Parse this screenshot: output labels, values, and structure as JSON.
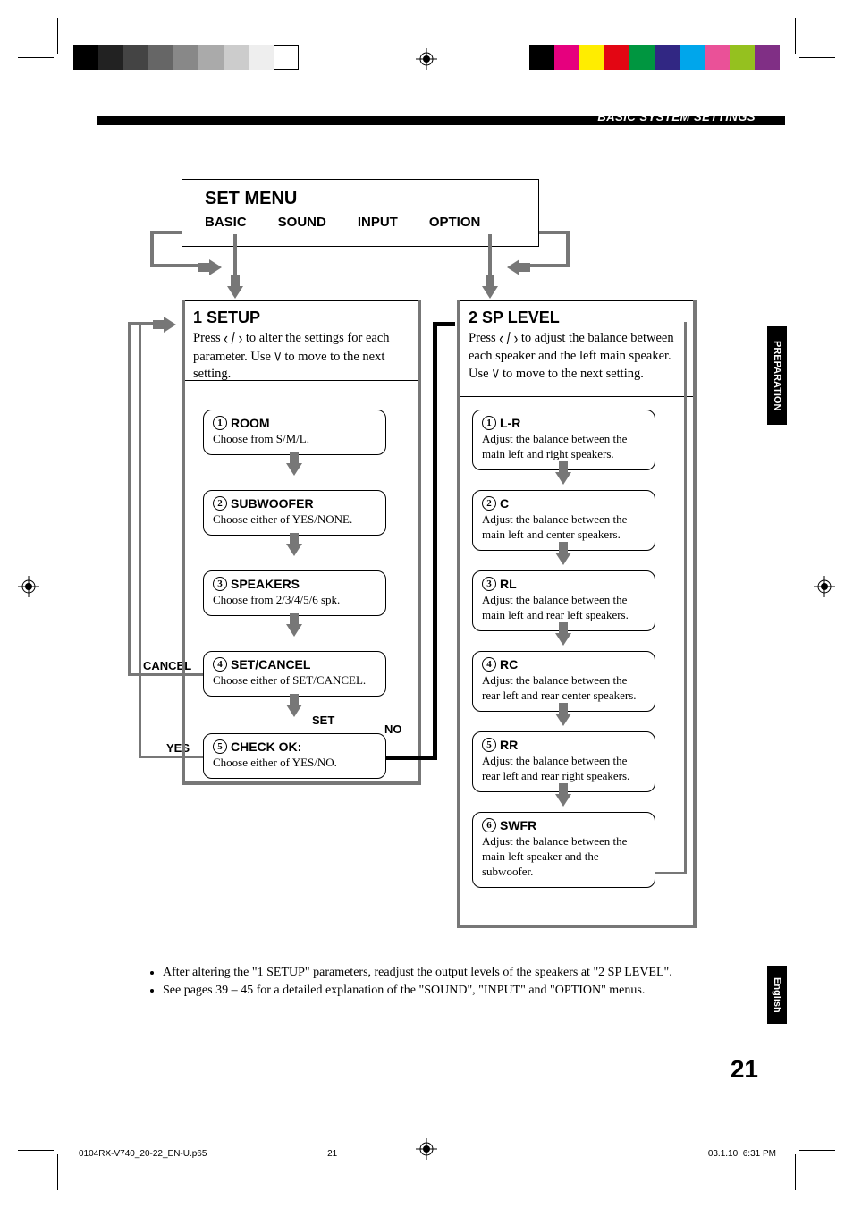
{
  "section_header": "BASIC SYSTEM SETTINGS",
  "side_tab_1": "PREPARATION",
  "side_tab_2": "English",
  "page_number": "21",
  "menu": {
    "title": "SET MENU",
    "items": [
      "BASIC",
      "SOUND",
      "INPUT",
      "OPTION"
    ]
  },
  "setup": {
    "title": "1   SETUP",
    "desc_a": "Press ",
    "desc_b": " to alter the settings for each parameter. Use ",
    "desc_c": " to move to the next setting.",
    "steps": [
      {
        "n": "1",
        "title": "ROOM",
        "text": "Choose from S/M/L."
      },
      {
        "n": "2",
        "title": "SUBWOOFER",
        "text": "Choose either of YES/NONE."
      },
      {
        "n": "3",
        "title": "SPEAKERS",
        "text": "Choose from 2/3/4/5/6 spk."
      },
      {
        "n": "4",
        "title": "SET/CANCEL",
        "text": "Choose either of SET/CANCEL."
      },
      {
        "n": "5",
        "title": "CHECK OK:",
        "text": "Choose either of YES/NO."
      }
    ]
  },
  "splevel": {
    "title": "2   SP LEVEL",
    "desc_a": "Press ",
    "desc_b": " to adjust the balance between each speaker and the left main speaker. Use ",
    "desc_c": " to move to the next setting.",
    "steps": [
      {
        "n": "1",
        "title": "L-R",
        "text": "Adjust the balance between the main left and right speakers."
      },
      {
        "n": "2",
        "title": "C",
        "text": "Adjust the balance between the main left and center speakers."
      },
      {
        "n": "3",
        "title": "RL",
        "text": "Adjust the balance between the main left and rear left speakers."
      },
      {
        "n": "4",
        "title": "RC",
        "text": "Adjust the balance between the rear left and rear center speakers."
      },
      {
        "n": "5",
        "title": "RR",
        "text": "Adjust the balance between the rear left and rear right speakers."
      },
      {
        "n": "6",
        "title": "SWFR",
        "text": "Adjust the balance between the main left speaker and the subwoofer."
      }
    ]
  },
  "labels": {
    "cancel": "CANCEL",
    "set": "SET",
    "yes": "YES",
    "no": "NO"
  },
  "notes": {
    "a": "After altering the \"1 SETUP\" parameters, readjust the output levels of the speakers at \"2 SP LEVEL\".",
    "b": "See pages 39 – 45 for a detailed explanation of the \"SOUND\", \"INPUT\" and \"OPTION\" menus."
  },
  "footer": {
    "file": "0104RX-V740_20-22_EN-U.p65",
    "page": "21",
    "datetime": "03.1.10, 6:31 PM"
  },
  "glyphs": {
    "lr": "‹ / ›",
    "down": "˅"
  }
}
